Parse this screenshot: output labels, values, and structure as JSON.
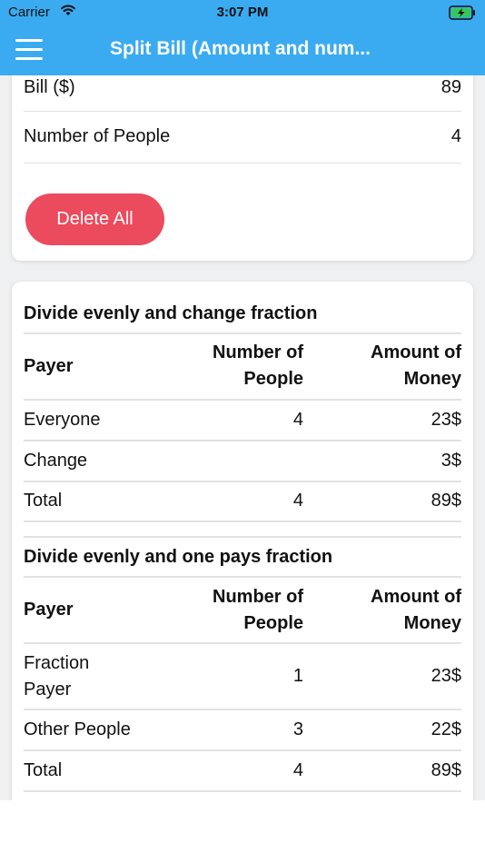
{
  "status_bar": {
    "carrier": "Carrier",
    "time": "3:07 PM"
  },
  "app_bar": {
    "title": "Split Bill (Amount and num..."
  },
  "inputs": {
    "bill_label": "Bill ($)",
    "bill_value": "89",
    "people_label": "Number of People",
    "people_value": "4",
    "delete_label": "Delete All"
  },
  "section1": {
    "title": "Divide evenly and change fraction",
    "headers": {
      "payer": "Payer",
      "people_1": "Number of",
      "people_2": "People",
      "money_1": "Amount of",
      "money_2": "Money"
    },
    "rows": [
      {
        "payer": "Everyone",
        "people": "4",
        "money": "23$"
      },
      {
        "payer": "Change",
        "people": "",
        "money": "3$"
      },
      {
        "payer": "Total",
        "people": "4",
        "money": "89$"
      }
    ]
  },
  "section2": {
    "title": "Divide evenly and one pays fraction",
    "headers": {
      "payer": "Payer",
      "people_1": "Number of",
      "people_2": "People",
      "money_1": "Amount of",
      "money_2": "Money"
    },
    "rows": [
      {
        "payer_1": "Fraction",
        "payer_2": "Payer",
        "people": "1",
        "money": "23$"
      },
      {
        "payer": "Other People",
        "people": "3",
        "money": "22$"
      },
      {
        "payer": "Total",
        "people": "4",
        "money": "89$"
      }
    ]
  },
  "colors": {
    "app_bar": "#3aabf1",
    "delete_button": "#ec4a5d",
    "background": "#eef0f2"
  }
}
